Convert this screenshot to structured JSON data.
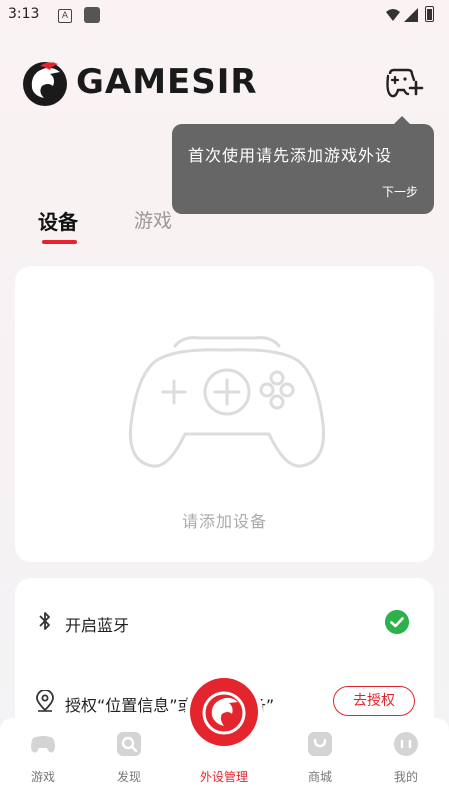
{
  "status_bar": {
    "time": "3:13",
    "a_badge": "A"
  },
  "header": {
    "brand": "GAMESIR",
    "add_device_icon": "gamepad-plus-icon"
  },
  "tooltip": {
    "text": "首次使用请先添加游戏外设",
    "next": "下一步"
  },
  "tabs": [
    {
      "label": "设备",
      "active": true
    },
    {
      "label": "游戏",
      "active": false
    }
  ],
  "add_card": {
    "label": "请添加设备",
    "icon": "gamepad-add-icon"
  },
  "settings": {
    "bluetooth": {
      "label": "开启蓝牙",
      "status": "enabled",
      "icon": "bluetooth-icon"
    },
    "location": {
      "label": "授权“位置信息”或“附近设备”",
      "button": "去授权",
      "icon": "location-pin-icon"
    }
  },
  "bottom_nav": [
    {
      "label": "游戏",
      "icon": "gamepad-icon",
      "active": false
    },
    {
      "label": "发现",
      "icon": "discover-icon",
      "active": false
    },
    {
      "label": "外设管理",
      "icon": "gamesir-logo-icon",
      "active": true
    },
    {
      "label": "商城",
      "icon": "shop-icon",
      "active": false
    },
    {
      "label": "我的",
      "icon": "profile-icon",
      "active": false
    }
  ],
  "colors": {
    "accent": "#e5252d",
    "success": "#2db14a",
    "tooltip_bg": "#666666"
  }
}
